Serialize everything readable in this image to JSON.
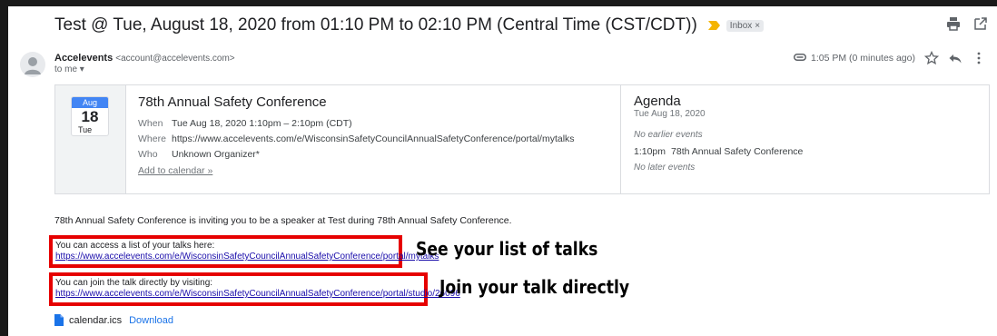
{
  "email": {
    "subject": "Test @ Tue, August 18, 2020 from 01:10 PM to 02:10 PM (Central Time (CST/CDT))",
    "label_chip": "Inbox",
    "label_close": "×",
    "sender_name": "Accelevents",
    "sender_email": "<account@accelevents.com>",
    "to_line": "to me ▾",
    "timestamp": "1:05 PM (0 minutes ago)"
  },
  "invite": {
    "calendar_month": "Aug",
    "calendar_day": "18",
    "calendar_dow": "Tue",
    "title": "78th Annual Safety Conference",
    "rows": [
      {
        "label": "When",
        "value": "Tue Aug 18, 2020 1:10pm – 2:10pm (CDT)"
      },
      {
        "label": "Where",
        "value": "https://www.accelevents.com/e/WisconsinSafetyCouncilAnnualSafetyConference/portal/mytalks"
      },
      {
        "label": "Who",
        "value": "Unknown Organizer*"
      }
    ],
    "add_to_calendar": "Add to calendar »"
  },
  "agenda": {
    "title": "Agenda",
    "date": "Tue Aug 18, 2020",
    "no_earlier": "No earlier events",
    "event_time": "1:10pm",
    "event_name": "78th Annual Safety Conference",
    "no_later": "No later events"
  },
  "body": {
    "intro": "78th Annual Safety Conference is inviting you to be a speaker at Test during 78th Annual Safety Conference.",
    "talks_text": "You can access a list of your talks here:",
    "talks_link": "https://www.accelevents.com/e/WisconsinSafetyCouncilAnnualSafetyConference/portal/mytalks",
    "join_text": "You can join the talk directly by visiting:",
    "join_link": "https://www.accelevents.com/e/WisconsinSafetyCouncilAnnualSafetyConference/portal/studio/26096"
  },
  "annotations": {
    "talks": "See your list of talks",
    "join": "Join your talk directly"
  },
  "attachment": {
    "filename": "calendar.ics",
    "download": "Download"
  },
  "colors": {
    "highlight_border": "#e60000",
    "calendar_blue": "#4285f4",
    "link_blue": "#1a0dab",
    "attachment_blue": "#1a73e8",
    "importance_marker": "#f4b400"
  },
  "icons": [
    "print-icon",
    "open-new-window-icon",
    "avatar-icon",
    "attachment-icon",
    "star-icon",
    "reply-icon",
    "more-icon",
    "importance-marker-icon",
    "file-icon"
  ]
}
